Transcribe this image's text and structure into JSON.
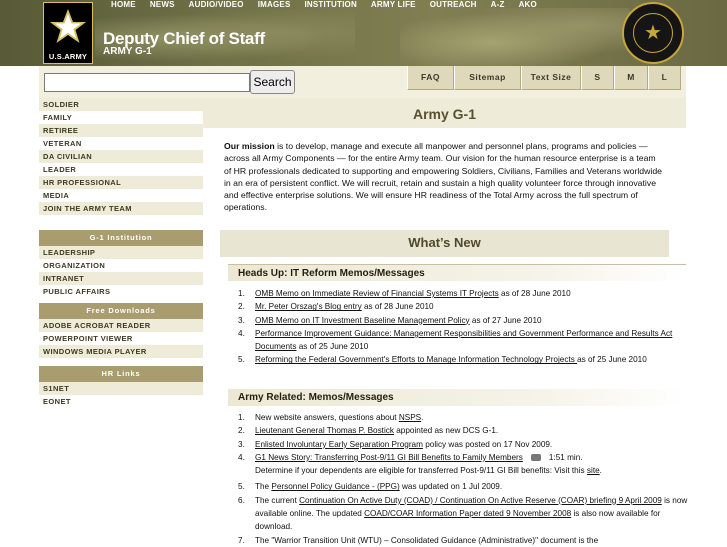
{
  "header": {
    "logo_text": "U.S.ARMY",
    "title": "Deputy Chief of Staff",
    "subtitle": "ARMY G-1",
    "nav": [
      "HOME",
      "NEWS",
      "AUDIO/VIDEO",
      "IMAGES",
      "INSTITUTION",
      "ARMY LIFE",
      "OUTREACH",
      "A-Z",
      "AKO"
    ]
  },
  "search": {
    "value": "",
    "placeholder": "",
    "button_label": "Search"
  },
  "tools": [
    "FAQ",
    "Sitemap",
    "Text Size",
    "S",
    "M",
    "L"
  ],
  "sidebar": {
    "main_items": [
      "SOLDIER",
      "FAMILY",
      "RETIREE",
      "VETERAN",
      "DA CIVILIAN",
      "LEADER",
      "HR PROFESSIONAL",
      "MEDIA",
      "JOIN THE ARMY TEAM"
    ],
    "institution_head": "G-1 Institution",
    "institution_items": [
      "LEADERSHIP",
      "ORGANIZATION",
      "INTRANET",
      "PUBLIC AFFAIRS"
    ],
    "downloads_head": "Free Downloads",
    "downloads_items": [
      "ADOBE ACROBAT READER",
      "POWERPOINT VIEWER",
      "WINDOWS MEDIA PLAYER"
    ],
    "links_head": "HR Links",
    "links_items": [
      "S1NET",
      "EONET"
    ]
  },
  "main": {
    "page_title": "Army G-1",
    "mission_label": "Our mission",
    "mission_text": " is to develop, manage and execute all manpower and personnel plans, programs and policies — across all Army Components — for the entire Army team. Our vision for the human resource enterprise is a team of HR professionals dedicated to supporting and empowering Soldiers, Civilians, Families and Veterans worldwide in an era of persistent conflict. We will recruit, retain and sustain a high quality volunteer force through innovative and effective enterprise solutions. We will ensure HR readiness of the Total Army across the full spectrum of operations.",
    "whats_new": "What’s New",
    "section1_title": "Heads Up: IT Reform Memos/Messages",
    "section1_items": [
      {
        "link": "OMB Memo on Immediate Review of Financial Systems IT Projects",
        "rest": " as of 28 June 2010"
      },
      {
        "link": "Mr. Peter Orszag's Blog entry",
        "rest": " as of 28 June 2010"
      },
      {
        "link": "OMB Memo on IT Investment Baseline Management Policy",
        "rest": " as of 27 June 2010"
      },
      {
        "link": "Performance Improvement Guidance: Management Responsibilities and Government Performance and Results Act Documents",
        "rest": " as of 25 June 2010"
      },
      {
        "link": "Reforming the Federal Government's Efforts to Manage Information Technology Projects ",
        "rest": "as of 25 June 2010"
      }
    ],
    "section2_title": "Army Related: Memos/Messages",
    "section2_items": [
      {
        "pre": "New website answers, questions about ",
        "link": "NSPS",
        "rest": "."
      },
      {
        "pre": "",
        "link": "Lieutenant General Thomas P. Bostick",
        "rest": " appointed as new DCS G-1."
      },
      {
        "pre": "",
        "link": "Enlisted Involuntary Early Separation Program",
        "rest": " policy was posted on 17 Nov 2009."
      },
      {
        "pre": "",
        "link": "G1 News Story: Transferring Post-9/11 GI Bill Benefits to Family Members",
        "rest": "1:51 min.",
        "note_pre": "Determine if your dependents are eligible for transferred Post-9/11 GI Bill benefits: Visit this ",
        "note_link": "site",
        "note_rest": "."
      },
      {
        "pre": "The ",
        "link": "Personnel Policy Guidance - (PPG)",
        "rest": " was updated on 1 Jul 2009."
      },
      {
        "pre": "The current ",
        "link": "Continuation On Active Duty (COAD) / Continuation On Active Reserve (COAR) briefing 9 April 2009",
        "rest": " is now available online. The updated ",
        "link2": "COAD/COAR Information Paper dated 9 November 2008",
        "rest2": " is also now available for download."
      },
      {
        "pre": "The \"Warrior Transition Unit (WTU) – Consolidated Guidance (Administrative)\" document is the",
        "link": "",
        "rest": ""
      }
    ]
  },
  "colors": {
    "header_olive": "#6f7046",
    "sidebar_head": "#a99d6f",
    "panel_bg": "#eeebd9",
    "seal_gold": "#c9a63c"
  }
}
